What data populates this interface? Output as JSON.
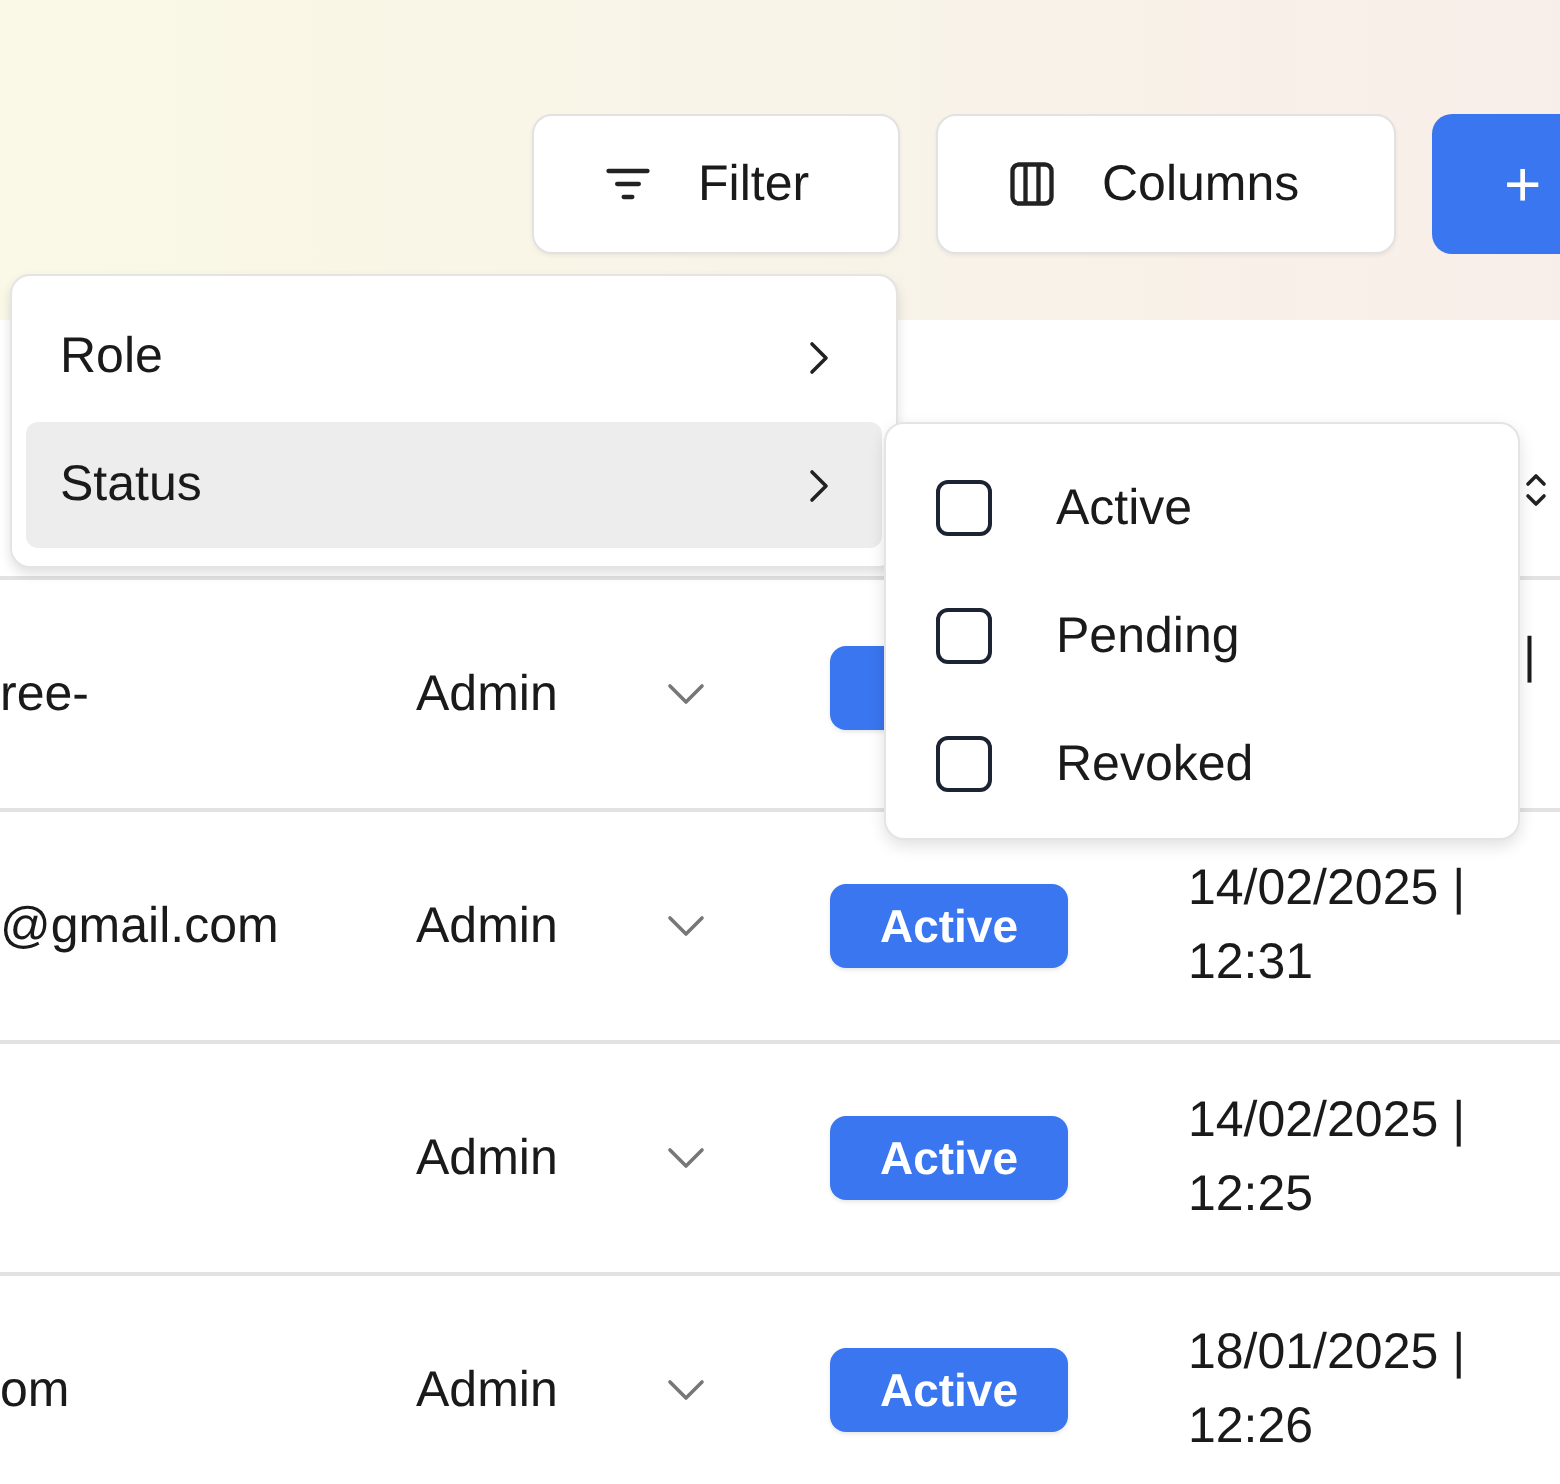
{
  "toolbar": {
    "buttons": [
      {
        "kind": "filter",
        "label": "Filter"
      },
      {
        "kind": "columns",
        "label": "Columns"
      },
      {
        "kind": "add",
        "label": "+"
      }
    ]
  },
  "filter_menu": {
    "items": [
      {
        "label": "Role",
        "selected": false
      },
      {
        "label": "Status",
        "selected": true
      }
    ]
  },
  "status_submenu": {
    "options": [
      {
        "label": "Active",
        "checked": false
      },
      {
        "label": "Pending",
        "checked": false
      },
      {
        "label": "Revoked",
        "checked": false
      }
    ]
  },
  "table": {
    "rows": [
      {
        "email": "ree-",
        "role": "Admin",
        "date_tail": "|"
      },
      {
        "email": "@gmail.com",
        "role": "Admin",
        "status": "Active",
        "date": "14/02/2025 |",
        "time": "12:31"
      },
      {
        "role": "Admin",
        "status": "Active",
        "date": "14/02/2025 |",
        "time": "12:25"
      },
      {
        "email": "om",
        "role": "Admin",
        "status": "Active",
        "date": "18/01/2025 |",
        "time": "12:26"
      }
    ]
  }
}
